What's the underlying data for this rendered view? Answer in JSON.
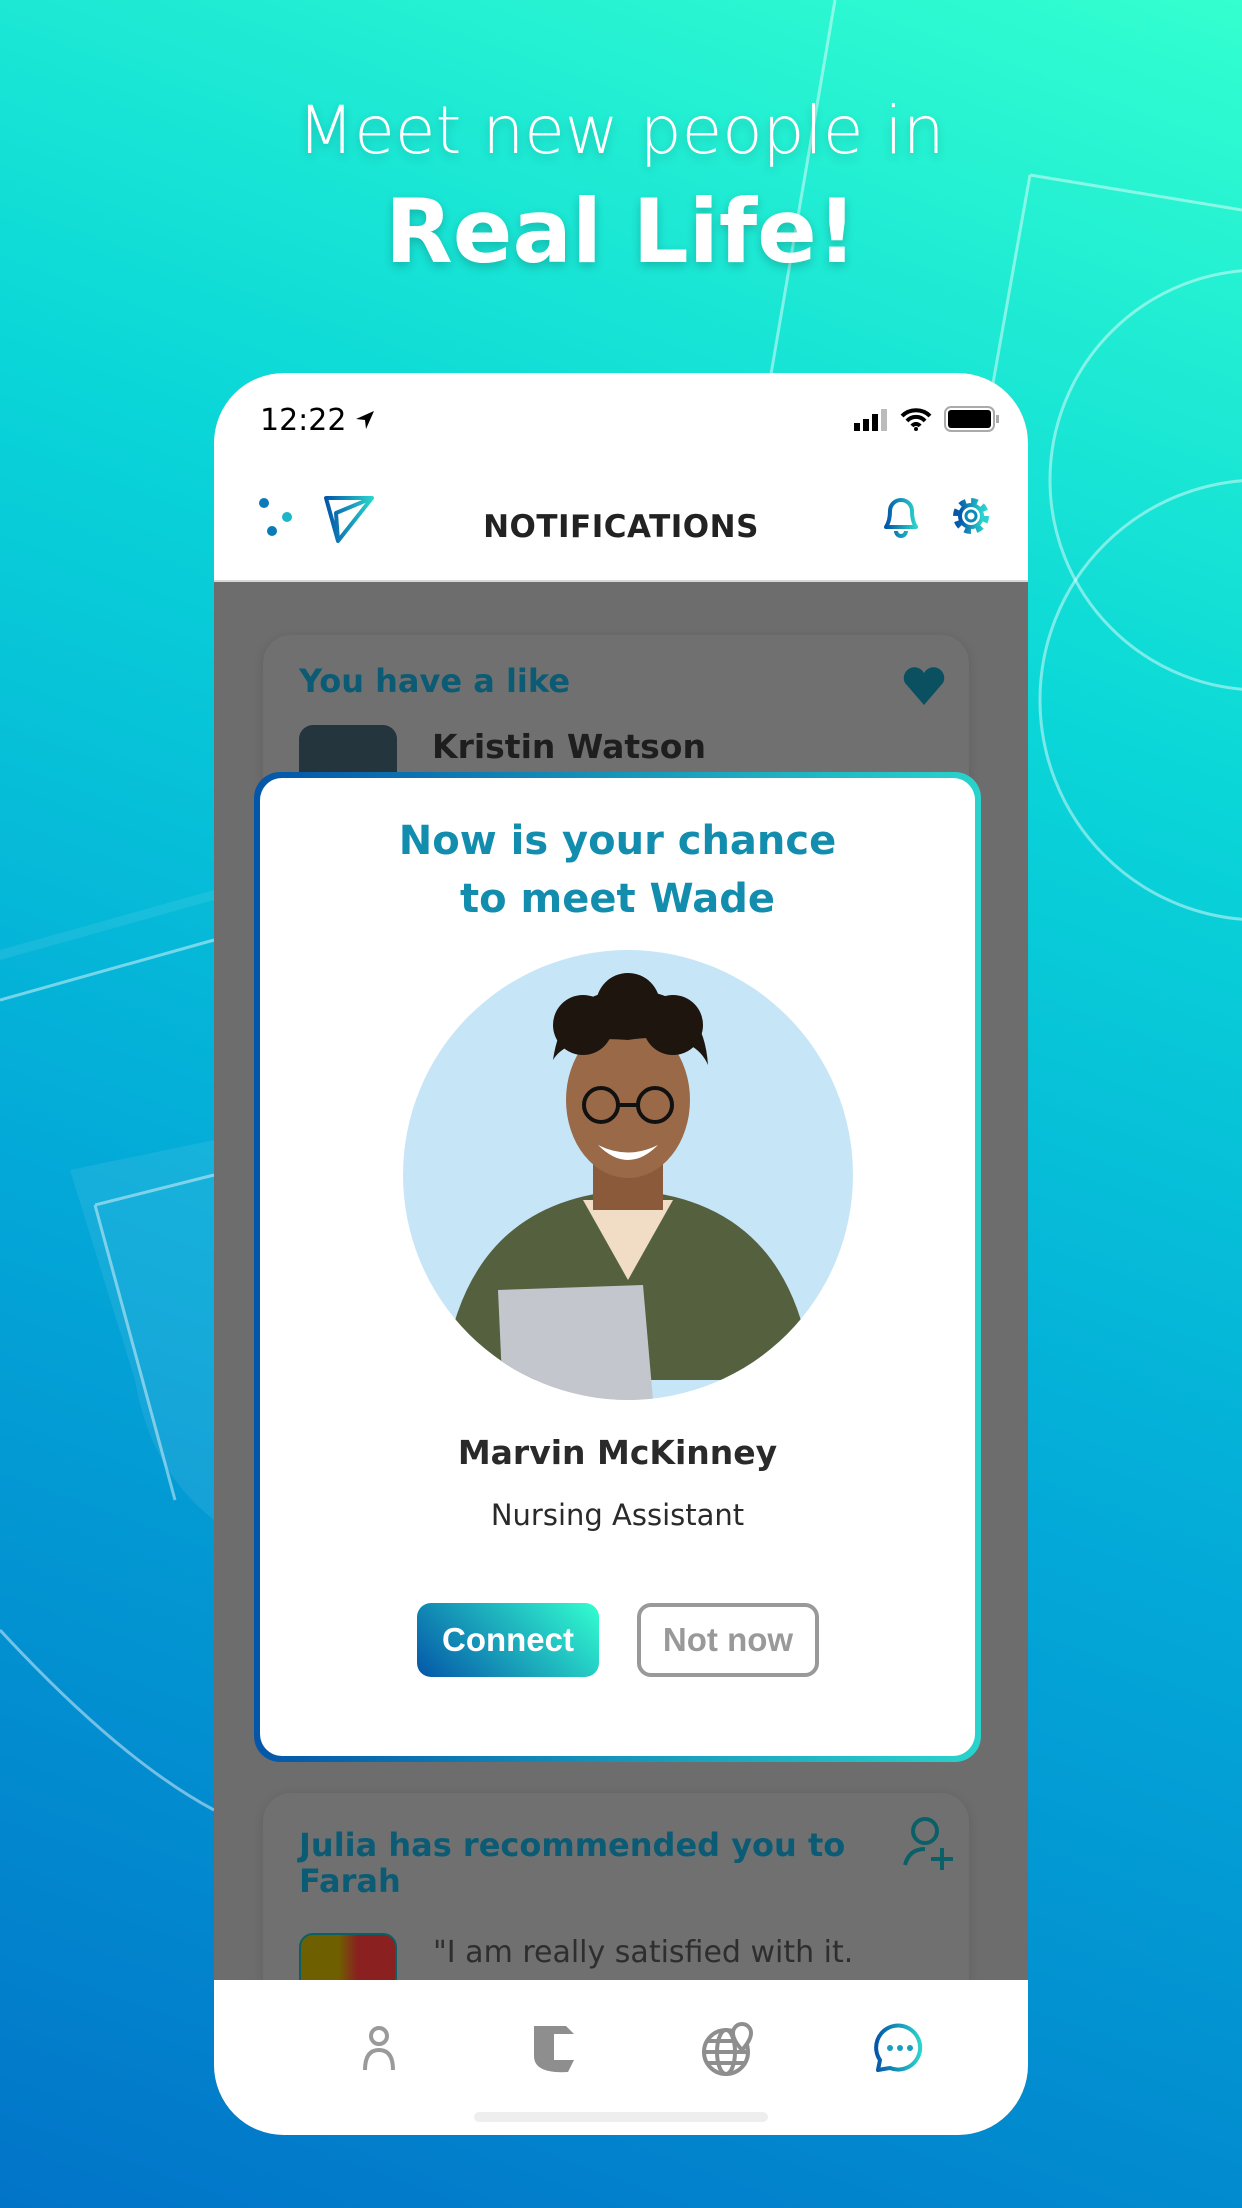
{
  "promo": {
    "line1": "Meet new people in",
    "line2": "Real Life!"
  },
  "status_bar": {
    "time": "12:22"
  },
  "header": {
    "title": "NOTIFICATIONS",
    "left_icons": [
      "sliders-icon",
      "send-icon"
    ],
    "right_icons": [
      "bell-icon",
      "gear-icon"
    ]
  },
  "cards": [
    {
      "title": "You have a like",
      "name": "Kristin Watson",
      "icon": "heart-icon"
    },
    {
      "title": "Julia has recommended you to Farah",
      "quote": "\"I am really satisfied with it.",
      "icon": "add-user-icon"
    }
  ],
  "modal": {
    "title_line1": "Now is your chance",
    "title_line2": "to meet Wade",
    "name": "Marvin McKinney",
    "role": "Nursing Assistant",
    "connect_label": "Connect",
    "not_now_label": "Not now"
  },
  "nav": {
    "items": [
      "profile-icon",
      "logo-icon",
      "globe-pin-icon",
      "chat-icon"
    ],
    "active": "chat-icon"
  },
  "colors": {
    "accent_start": "#0456a8",
    "accent_end": "#33ffd0",
    "title_teal": "#128dad",
    "overlay": "#6d6d6d"
  }
}
